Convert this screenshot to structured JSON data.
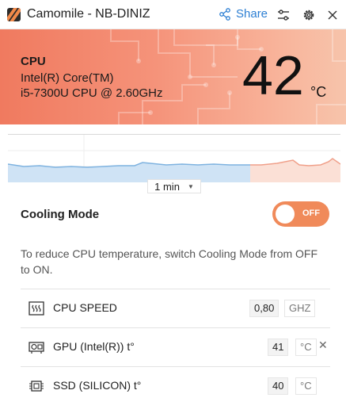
{
  "window": {
    "title": "Camomile - NB-DINIZ",
    "share_label": "Share",
    "icons": [
      "share-icon",
      "sliders-icon",
      "gear-icon"
    ]
  },
  "cpu": {
    "label": "CPU",
    "name_line1": "Intel(R) Core(TM)",
    "name_line2": "i5-7300U CPU @ 2.60GHz",
    "temperature": "42",
    "unit": "°C"
  },
  "graph": {
    "time_range": "1 min",
    "colors": {
      "cool": "#7fb3e0",
      "hot": "#f0a08a"
    }
  },
  "cooling": {
    "title": "Cooling Mode",
    "toggle_label": "OFF",
    "description": "To reduce CPU temperature, switch Cooling Mode from OFF to ON.",
    "accent": "#f08a5a"
  },
  "rows": [
    {
      "label": "CPU SPEED",
      "value": "0,80",
      "unit": "GHZ",
      "icon": "heat-icon"
    },
    {
      "label": "GPU (Intel(R)) t°",
      "value": "41",
      "unit": "°C",
      "icon": "gpu-icon",
      "close": "✕"
    },
    {
      "label": "SSD (SILICON) t°",
      "value": "40",
      "unit": "°C",
      "icon": "chip-icon"
    }
  ]
}
